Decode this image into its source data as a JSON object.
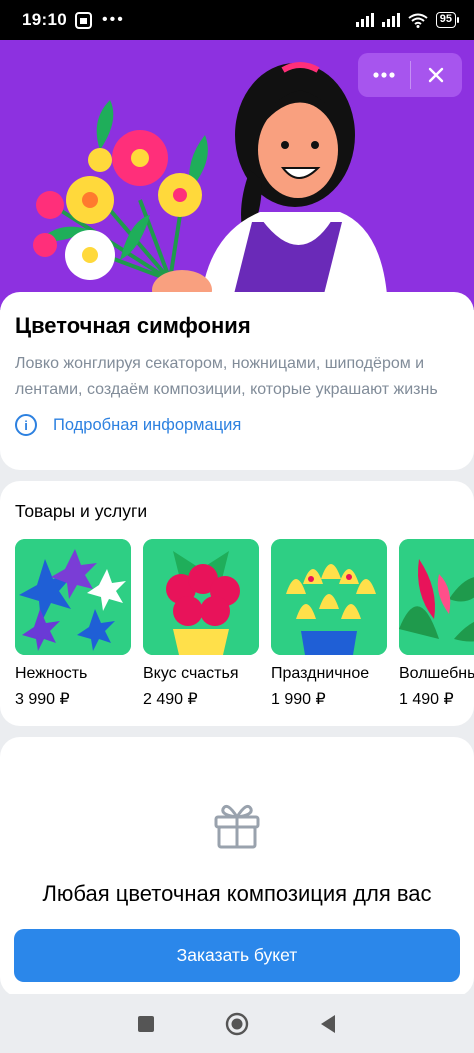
{
  "status_bar": {
    "time": "19:10",
    "dots": "•••",
    "battery": "95"
  },
  "hero": {
    "more_icon": "more-horizontal-icon",
    "close_icon": "close-icon"
  },
  "shop": {
    "title": "Цветочная симфония",
    "description": "Ловко жонглируя секатором, ножницами, шиподёром и лентами, создаём композиции, которые украшают жизнь",
    "info_link": "Подробная информация"
  },
  "products": {
    "section_title": "Товары и услуги",
    "items": [
      {
        "name": "Нежность",
        "price": "3 990 ₽"
      },
      {
        "name": "Вкус счастья",
        "price": "2 490 ₽"
      },
      {
        "name": "Праздничное",
        "price": "1 990 ₽"
      },
      {
        "name": "Волшебный",
        "price": "1 490 ₽"
      }
    ]
  },
  "promo": {
    "icon": "gift-icon",
    "title": "Любая цветочная композиция для вас"
  },
  "order_button": {
    "label": "Заказать букет"
  },
  "colors": {
    "hero_bg": "#8d31e0",
    "accent": "#2b87ea",
    "link": "#2d81e0",
    "product_bg": "#2ecf84"
  }
}
